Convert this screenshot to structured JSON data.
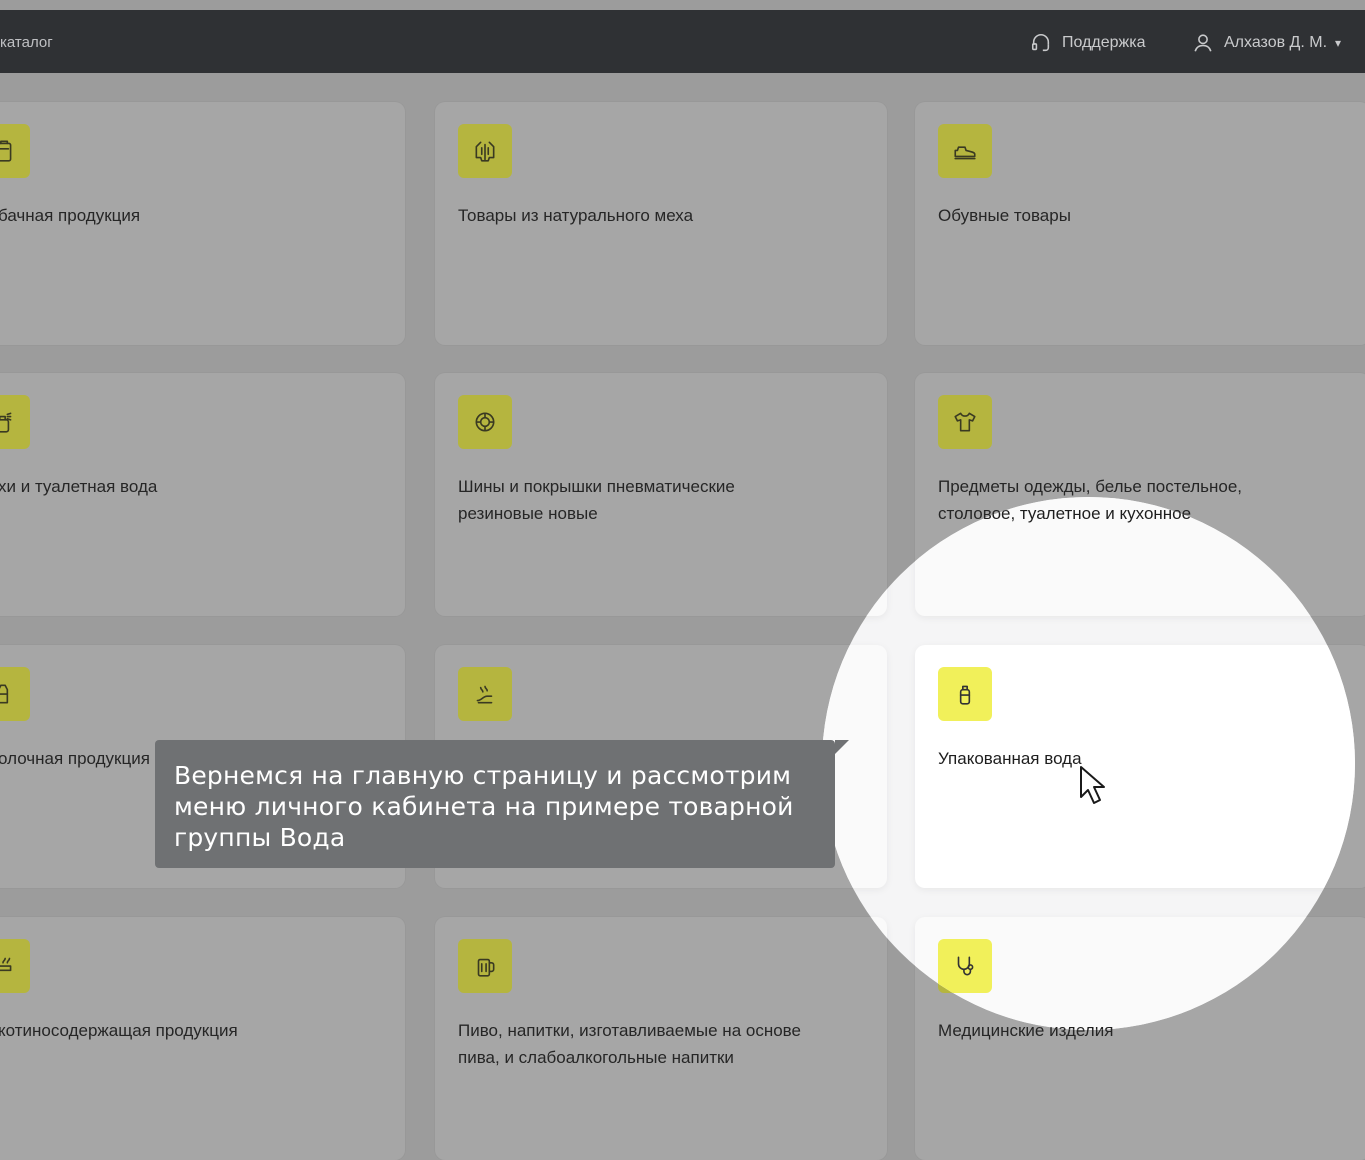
{
  "topbar": {
    "breadcrumb": "каталог",
    "support_label": "Поддержка",
    "user_name": "Алхазов Д. М."
  },
  "cards": [
    {
      "label": "бачная продукция",
      "icon": "tobacco-icon"
    },
    {
      "label": "Товары из натурального меха",
      "icon": "fur-coat-icon"
    },
    {
      "label": "Обувные товары",
      "icon": "shoe-icon"
    },
    {
      "label": "хи и туалетная вода",
      "icon": "perfume-icon"
    },
    {
      "label": "Шины и покрышки пневматические\nрезиновые новые",
      "icon": "tire-icon"
    },
    {
      "label": "Предметы одежды, белье постельное,\nстоловое, туалетное и кухонное",
      "icon": "tshirt-icon"
    },
    {
      "label": "олочная продукция",
      "icon": "dairy-icon"
    },
    {
      "label": "",
      "icon": "product-icon"
    },
    {
      "label": "Упакованная вода",
      "icon": "water-bottle-icon"
    },
    {
      "label": "котиносодержащая продукция",
      "icon": "nicotine-icon"
    },
    {
      "label": "Пиво, напитки, изготавливаемые на основе\nпива, и слабоалкогольные напитки",
      "icon": "beer-icon"
    },
    {
      "label": "Медицинские изделия",
      "icon": "stethoscope-icon"
    }
  ],
  "tooltip": {
    "text": "Вернемся на главную страницу и рассмотрим\nменю личного кабинета на примере товарной\nгруппы Вода"
  },
  "colors": {
    "accent": "#f1f05a",
    "topbar": "#2f3134",
    "overlay": "#9c9c9c"
  }
}
